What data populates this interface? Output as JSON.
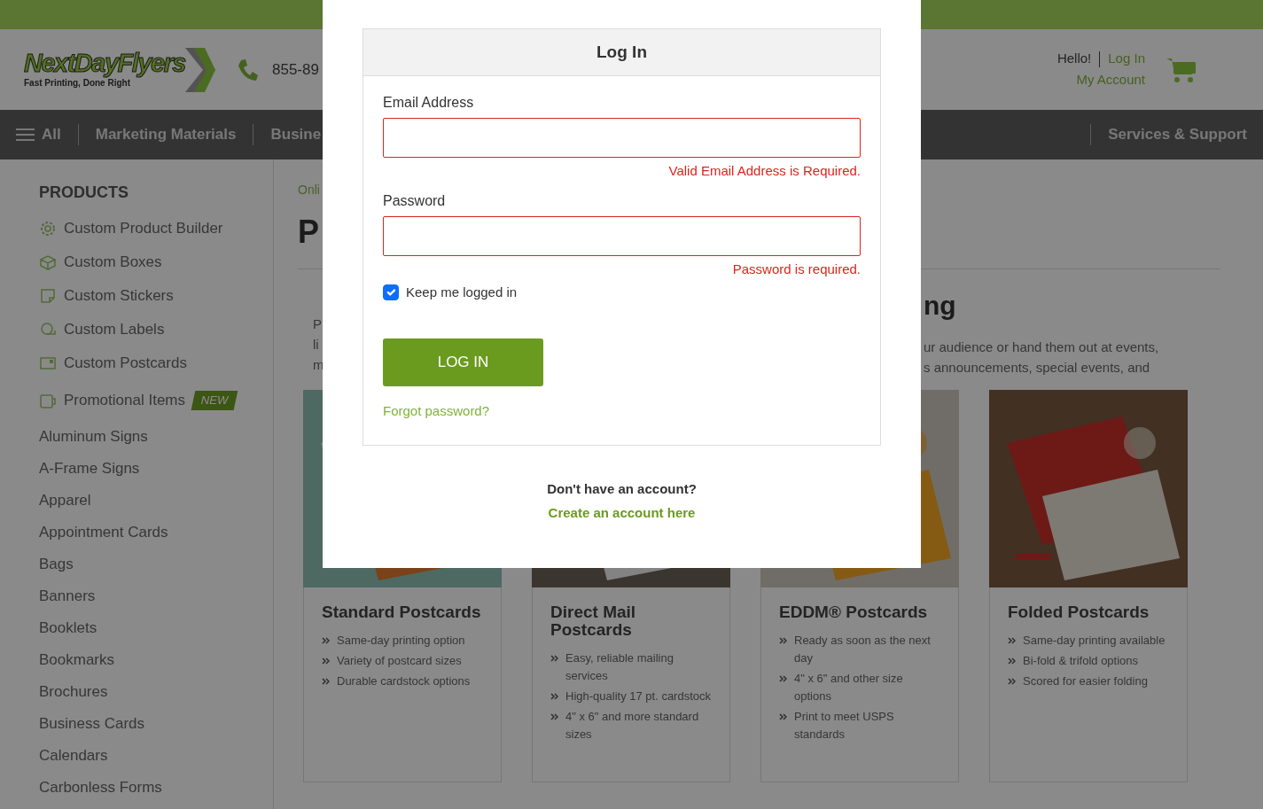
{
  "header": {
    "logo": {
      "name": "NextDayFlyers",
      "tagline": "Fast Printing, Done Right"
    },
    "phone": "855-89",
    "greeting": "Hello!",
    "login_link": "Log In",
    "account_link": "My Account"
  },
  "nav": {
    "items": [
      "All",
      "Marketing Materials",
      "Busine"
    ],
    "right_item": "Services & Support"
  },
  "sidebar": {
    "title": "PRODUCTS",
    "items": [
      {
        "label": "Custom Product Builder",
        "kind": "icon"
      },
      {
        "label": "Custom Boxes",
        "kind": "icon"
      },
      {
        "label": "Custom Stickers",
        "kind": "icon"
      },
      {
        "label": "Custom Labels",
        "kind": "icon"
      },
      {
        "label": "Custom Postcards",
        "kind": "icon"
      },
      {
        "label": "Promotional Items",
        "kind": "icon",
        "badge": "NEW"
      },
      {
        "label": "Aluminum Signs",
        "kind": "plain"
      },
      {
        "label": "A-Frame Signs",
        "kind": "plain"
      },
      {
        "label": "Apparel",
        "kind": "plain"
      },
      {
        "label": "Appointment Cards",
        "kind": "plain"
      },
      {
        "label": "Bags",
        "kind": "plain"
      },
      {
        "label": "Banners",
        "kind": "plain"
      },
      {
        "label": "Booklets",
        "kind": "plain"
      },
      {
        "label": "Bookmarks",
        "kind": "plain"
      },
      {
        "label": "Brochures",
        "kind": "plain"
      },
      {
        "label": "Business Cards",
        "kind": "plain"
      },
      {
        "label": "Calendars",
        "kind": "plain"
      },
      {
        "label": "Carbonless Forms",
        "kind": "plain"
      }
    ]
  },
  "main": {
    "breadcrumb": "Onli",
    "title": "P",
    "section_heading": "ng",
    "intro_left": [
      "P",
      "li",
      "m"
    ],
    "intro_right": [
      "ur audience or hand them out at events,",
      "s announcements, special events, and"
    ],
    "cards": [
      {
        "title": "Standard Postcards",
        "image": {
          "kind": "picture"
        },
        "features": [
          "Same-day printing option",
          "Variety of postcard sizes",
          "Durable cardstock options"
        ]
      },
      {
        "title": "Direct Mail Postcards",
        "image": {
          "kind": "picture"
        },
        "features": [
          "Easy, reliable mailing services",
          "High-quality 17 pt. cardstock",
          "4\" x 6\" and more standard sizes"
        ]
      },
      {
        "title": "EDDM® Postcards",
        "image": {
          "kind": "picture"
        },
        "features": [
          "Ready as soon as the next day",
          "4\" x 6\" and other size options",
          "Print to meet USPS standards"
        ]
      },
      {
        "title": "Folded Postcards",
        "image": {
          "kind": "picture"
        },
        "features": [
          "Same-day printing available",
          "Bi-fold & trifold options",
          "Scored for easier folding"
        ]
      }
    ]
  },
  "login_modal": {
    "title": "Log In",
    "fields": [
      {
        "label": "Email Address",
        "invalid": true,
        "error": "Valid Email Address is Required."
      },
      {
        "label": "Password",
        "invalid": true,
        "error": "Password is required."
      }
    ],
    "remember": {
      "label": "Keep me logged in",
      "checked": true
    },
    "submit": "LOG IN",
    "forgot_link": "Forgot password?",
    "signup_prompt": "Don't have an account?",
    "signup_link": "Create an account here"
  }
}
